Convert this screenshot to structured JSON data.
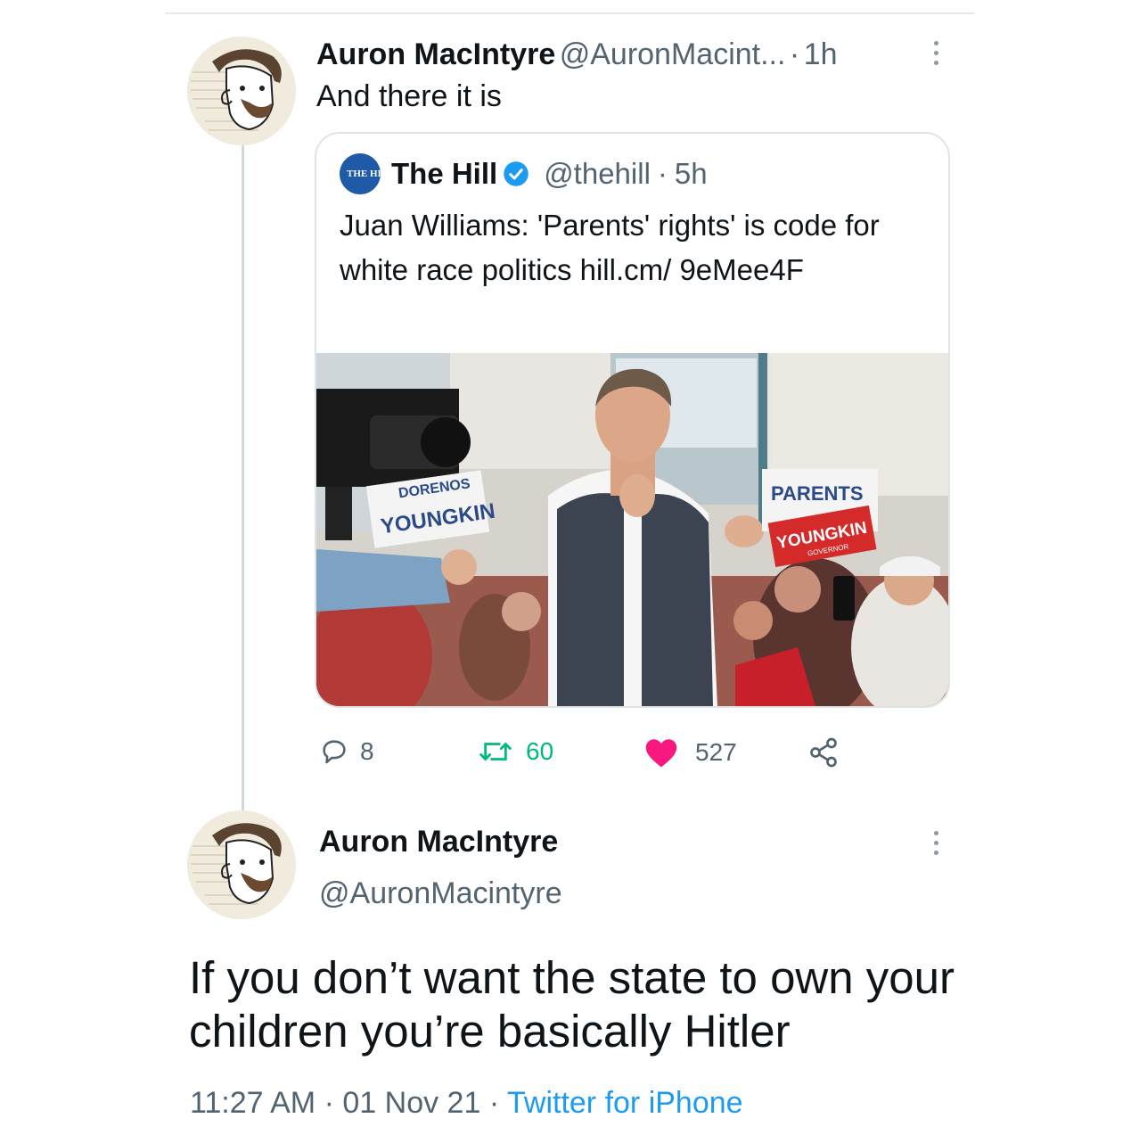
{
  "reply_tweet": {
    "author_name": "Auron MacIntyre",
    "author_handle": "@AuronMacint...",
    "time_sep": "·",
    "time": "1h",
    "text": "And there it is"
  },
  "quoted_tweet": {
    "logo_text": "THE HILL",
    "author_name": "The Hill",
    "author_handle": "@thehill",
    "time_sep": "·",
    "time": "5h",
    "text": "Juan Williams: 'Parents' rights' is code for white race politics hill.cm/ 9eMee4F",
    "image": {
      "sign_left_top": "DORENOS",
      "sign_left_bottom": "YOUNGKIN",
      "sign_right_top": "PARENTS",
      "sign_right_main": "YOUNGKIN",
      "sign_right_sub": "GOVERNOR"
    }
  },
  "actions": {
    "replies": "8",
    "retweets": "60",
    "likes": "527"
  },
  "main_tweet": {
    "author_name": "Auron MacIntyre",
    "author_handle": "@AuronMacintyre",
    "text": "If you don’t want the state to own your children you’re basically Hitler",
    "time": "11:27 AM",
    "date": "01 Nov 21",
    "sep": "·",
    "source": "Twitter for iPhone"
  },
  "colors": {
    "link_blue": "#1d9bf0",
    "like_red": "#f91880",
    "retweet_green": "#00ba7c",
    "muted_text": "#536471",
    "hill_blue": "#1f5aa8"
  },
  "icons": [
    "reply-icon",
    "retweet-icon",
    "like-icon",
    "share-icon",
    "verified-icon",
    "more-icon"
  ]
}
